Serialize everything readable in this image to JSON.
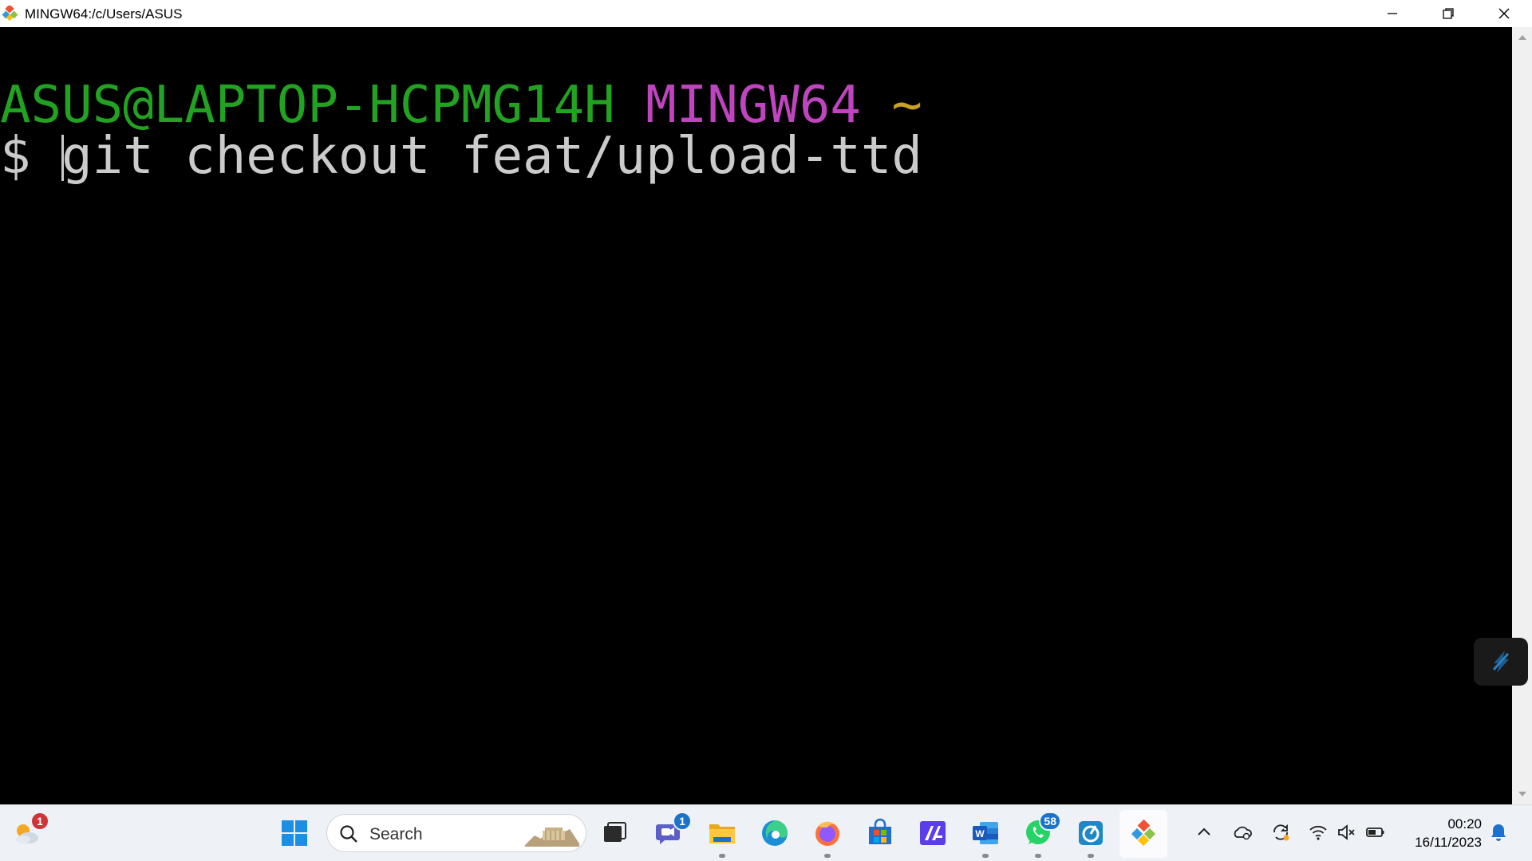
{
  "window": {
    "title": "MINGW64:/c/Users/ASUS",
    "controls": {
      "minimize": "minimize",
      "restore": "restore",
      "close": "close"
    }
  },
  "terminal": {
    "prompt_user_host": "ASUS@LAPTOP-HCPMG14H",
    "prompt_env": "MINGW64",
    "prompt_path": "~",
    "prompt_symbol": "$",
    "command": "git checkout feat/upload-ttd",
    "colors": {
      "user_host": "#21a321",
      "env": "#c044c0",
      "path": "#c9a125",
      "text": "#cbcbcb",
      "background": "#000000"
    }
  },
  "taskbar": {
    "search_placeholder": "Search",
    "widgets_badge": "1",
    "teams_badge": "1",
    "whatsapp_badge": "58",
    "apps": [
      "start",
      "search",
      "task-view",
      "teams",
      "file-explorer",
      "edge",
      "firefox",
      "microsoft-store",
      "visual-studio",
      "word",
      "whatsapp",
      "app",
      "git-bash"
    ]
  },
  "tray": {
    "time": "00:20",
    "date": "16/11/2023",
    "icons": [
      "chevron-up-icon",
      "onedrive-icon",
      "sync-icon",
      "wifi-icon",
      "volume-muted-icon",
      "battery-icon",
      "notification-bell-icon"
    ]
  }
}
